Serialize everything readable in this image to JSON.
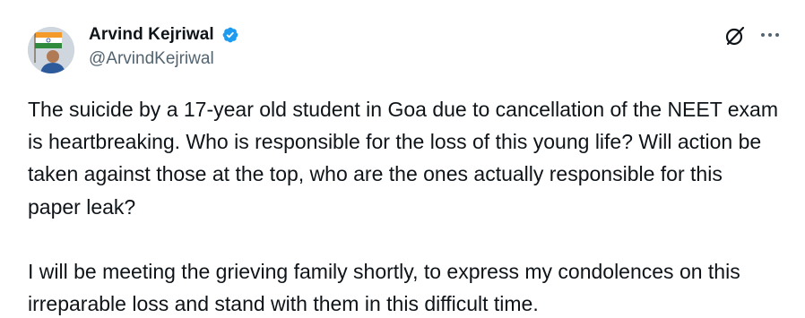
{
  "author": {
    "display_name": "Arvind Kejriwal",
    "handle": "@ArvindKejriwal",
    "verified": true,
    "verified_color": "#1d9bf0"
  },
  "actions": {
    "grok_icon": "slashed-circle-icon",
    "more_icon": "ellipsis-icon"
  },
  "tweet": {
    "paragraph_1": "The suicide by a 17-year old student in Goa due to cancellation of the NEET exam is heartbreaking. Who is responsible for the loss of this young life? Will action be taken against those at the top, who are the ones actually responsible for this paper leak?",
    "paragraph_2": "I will be meeting the grieving family shortly, to express my condolences on this irreparable loss and stand with them in this difficult time."
  },
  "colors": {
    "text": "#0f1419",
    "secondary_text": "#536471",
    "background": "#ffffff"
  }
}
